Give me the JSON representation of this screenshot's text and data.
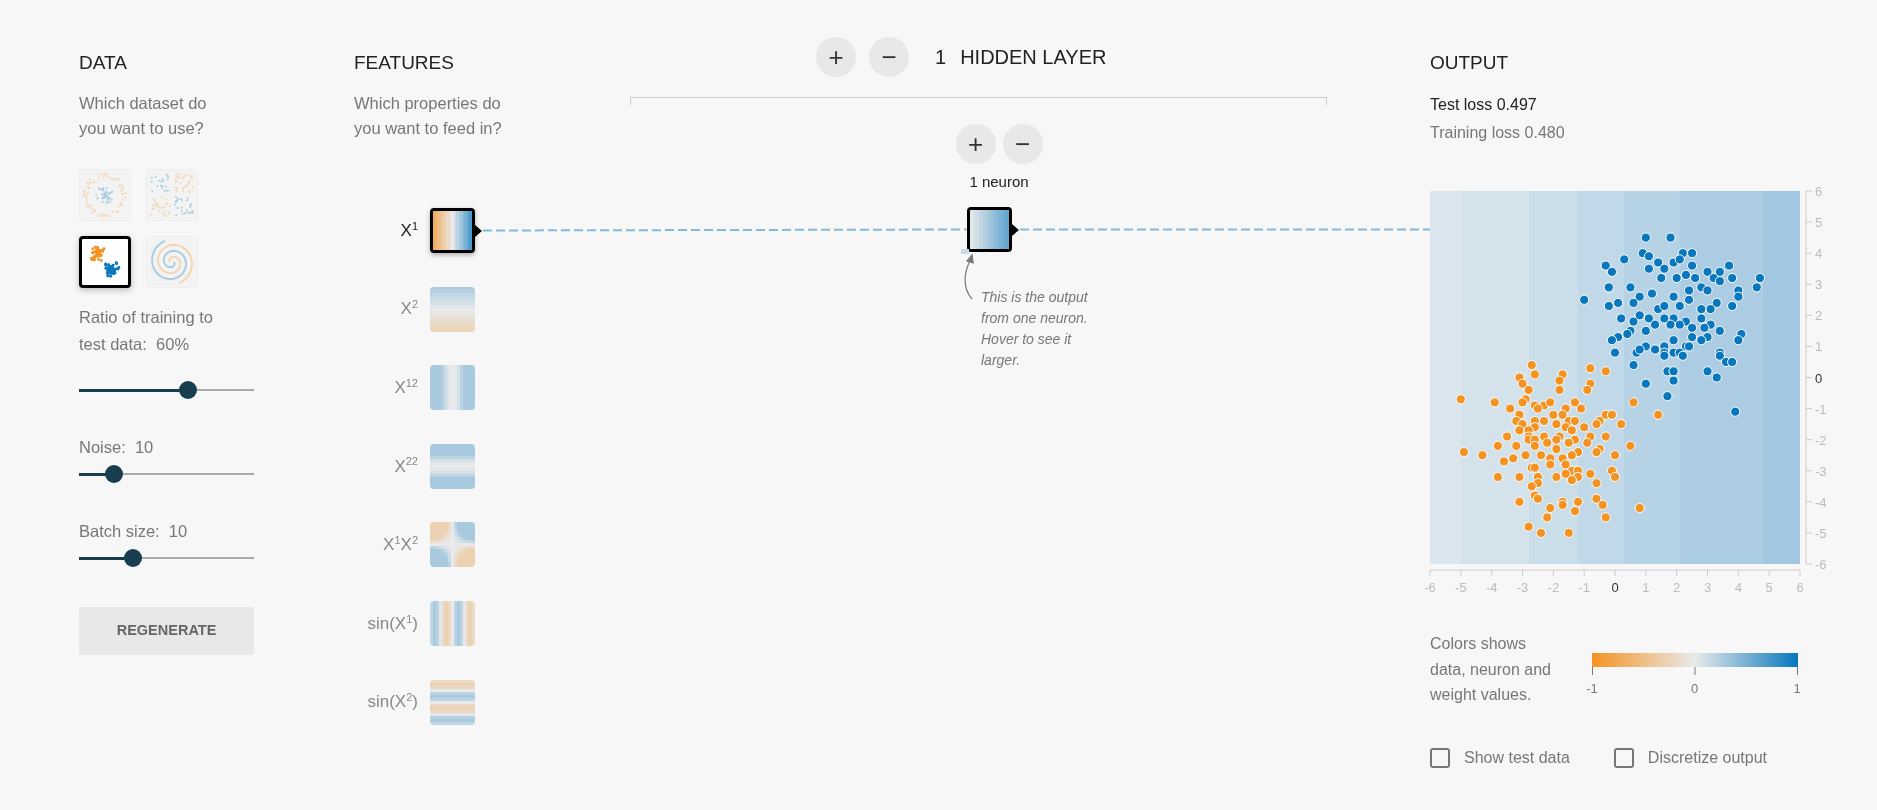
{
  "data_panel": {
    "title": "DATA",
    "subtitle": "Which dataset do you want to use?",
    "datasets": [
      {
        "kind": "circle",
        "selected": false
      },
      {
        "kind": "xor",
        "selected": false
      },
      {
        "kind": "gauss",
        "selected": true
      },
      {
        "kind": "spiral",
        "selected": false
      }
    ],
    "sliders": [
      {
        "label": "Ratio of training to test data:",
        "value": "60%",
        "level": 0.62
      },
      {
        "label": "Noise:",
        "value": "10",
        "level": 0.2
      },
      {
        "label": "Batch size:",
        "value": "10",
        "level": 0.31
      }
    ],
    "regenerate_button": "REGENERATE"
  },
  "features_panel": {
    "title": "FEATURES",
    "subtitle": "Which properties do you want to feed in?",
    "features": [
      {
        "label": "X$^{1}$",
        "kind": "x1",
        "selected": true
      },
      {
        "label": "X$^{2}$",
        "kind": "x2",
        "selected": false
      },
      {
        "label": "X$^{12}$",
        "kind": "x1sq",
        "selected": false
      },
      {
        "label": "X$^{22}$",
        "kind": "x2sq",
        "selected": false
      },
      {
        "label": "X$^{1}$X$^{2}$",
        "kind": "x1x2",
        "selected": false
      },
      {
        "label": "sin(X$^{1}$)",
        "kind": "sinx1",
        "selected": false
      },
      {
        "label": "sin(X$^{2}$)",
        "kind": "sinx2",
        "selected": false
      }
    ]
  },
  "network": {
    "add_layer_button": "+",
    "remove_layer_button": "−",
    "layer_count": "1",
    "layer_label": "HIDDEN LAYER",
    "layers": [
      {
        "add_neuron_button": "+",
        "remove_neuron_button": "−",
        "neuron_count": "1 neuron",
        "neurons": [
          {
            "kind": "neuron"
          }
        ]
      }
    ],
    "note": "This is the output from one neuron. Hover to see it larger."
  },
  "output_panel": {
    "title": "OUTPUT",
    "test_loss": "Test loss 0.497",
    "training_loss": "Training loss 0.480",
    "chart_data": {
      "type": "scatter",
      "xlim": [
        -6,
        6
      ],
      "ylim": [
        -6,
        6
      ],
      "xticks": [
        {
          "value": -6,
          "label": "-6"
        },
        {
          "value": -5,
          "label": "-5"
        },
        {
          "value": -4,
          "label": "-4"
        },
        {
          "value": -3,
          "label": "-3"
        },
        {
          "value": -2,
          "label": "-2"
        },
        {
          "value": -1,
          "label": "-1"
        },
        {
          "value": 0,
          "label": "0"
        },
        {
          "value": 1,
          "label": "1"
        },
        {
          "value": 2,
          "label": "2"
        },
        {
          "value": 3,
          "label": "3"
        },
        {
          "value": 4,
          "label": "4"
        },
        {
          "value": 5,
          "label": "5"
        },
        {
          "value": 6,
          "label": "6"
        }
      ],
      "yticks": [
        {
          "value": -6,
          "label": "-6"
        },
        {
          "value": -5,
          "label": "-5"
        },
        {
          "value": -4,
          "label": "-4"
        },
        {
          "value": -3,
          "label": "-3"
        },
        {
          "value": -2,
          "label": "-2"
        },
        {
          "value": -1,
          "label": "-1"
        },
        {
          "value": 0,
          "label": "0"
        },
        {
          "value": 1,
          "label": "1"
        },
        {
          "value": 2,
          "label": "2"
        },
        {
          "value": 3,
          "label": "3"
        },
        {
          "value": 4,
          "label": "4"
        },
        {
          "value": 5,
          "label": "5"
        },
        {
          "value": 6,
          "label": "6"
        }
      ],
      "series": [
        {
          "color": "#0877bd",
          "x": [
            1.0,
            1.8,
            0.9,
            2.2,
            2.5,
            1.1,
            1.4,
            1.9,
            2.1,
            0.3,
            -0.3,
            -0.1,
            1.1,
            1.6,
            2.5,
            3.0,
            3.7,
            3.4,
            3.8,
            4.7,
            4.6,
            4.0,
            4.0,
            3.8,
            3.3,
            3.2,
            3.4,
            2.3,
            1.5,
            2.0,
            2.6,
            -0.2,
            0.5,
            -1.0,
            -0.2,
            0.1,
            0.8,
            1.2,
            1.9,
            2.4,
            2.8,
            3.0,
            0.6,
            1.4,
            1.6,
            2.1,
            2.8,
            3.1,
            0.2,
            0.6,
            0.8,
            1.1,
            1.6,
            1.9,
            2.3,
            2.8,
            3.4,
            3.1,
            2.9,
            2.5,
            2.1,
            1.8,
            1.3,
            1.0,
            0.5,
            0.1,
            -0.1,
            0.4,
            1.9,
            2.5,
            3.0,
            2.8,
            4.1,
            4.0,
            1.0,
            1.3,
            1.6,
            2.3,
            2.4,
            0.0,
            0.7,
            0.8,
            1.6,
            1.9,
            2.1,
            1.6,
            2.2,
            3.4,
            3.4,
            3.6,
            3.8,
            0.6,
            1.7,
            1.9,
            3.0,
            3.3,
            1.0,
            1.9,
            1.7,
            3.9,
            2.4
          ],
          "values": [
            4.5,
            4.5,
            4.0,
            4.0,
            4.0,
            3.9,
            3.7,
            3.7,
            3.8,
            3.8,
            3.6,
            3.4,
            3.5,
            3.5,
            3.6,
            3.4,
            3.6,
            3.4,
            3.2,
            3.2,
            2.9,
            2.8,
            2.6,
            2.3,
            2.4,
            3.2,
            3.1,
            3.3,
            3.2,
            3.2,
            3.2,
            2.9,
            2.9,
            2.5,
            2.3,
            2.4,
            2.6,
            2.7,
            2.6,
            2.5,
            2.9,
            2.8,
            2.4,
            2.2,
            2.3,
            2.3,
            2.2,
            2.2,
            1.9,
            1.8,
            2.0,
            1.9,
            1.9,
            1.9,
            1.8,
            1.9,
            1.5,
            1.7,
            1.6,
            1.6,
            1.7,
            1.7,
            1.7,
            1.5,
            1.5,
            1.3,
            1.2,
            1.4,
            1.2,
            1.3,
            1.3,
            1.2,
            1.4,
            1.2,
            1.0,
            0.9,
            1.0,
            1.0,
            1.0,
            0.8,
            0.8,
            0.9,
            0.8,
            0.8,
            0.8,
            0.7,
            0.7,
            0.8,
            0.7,
            0.5,
            0.5,
            0.4,
            0.2,
            0.2,
            0.2,
            0.0,
            -0.2,
            -0.1,
            -0.6,
            -1.1,
            2.8
          ]
        },
        {
          "color": "#f59322",
          "x": [
            -2.7,
            -2.6,
            -3.1,
            -3.0,
            -2.8,
            -1.7,
            -1.8,
            -1.8,
            -0.8,
            -0.3,
            -0.8,
            -0.9,
            -5.0,
            -3.9,
            -2.9,
            -3.0,
            -2.6,
            -2.3,
            -2.1,
            -1.3,
            -1.1,
            -1.6,
            0.6,
            -3.4,
            -3.1,
            -2.5,
            -2.0,
            -1.7,
            -0.3,
            -0.1,
            1.4,
            -3.2,
            -2.6,
            -2.3,
            -1.5,
            -1.3,
            -0.5,
            0.2,
            -3.0,
            -2.6,
            -1.9,
            -1.0,
            -0.6,
            -3.1,
            -2.8,
            -1.6,
            -1.4,
            -0.8,
            -2.8,
            -2.3,
            -1.8,
            -3.5,
            -2.8,
            -2.6,
            -1.9,
            -1.3,
            -0.3,
            -2.2,
            -1.5,
            -3.8,
            -3.2,
            -2.6,
            -0.9,
            0.5,
            -1.9,
            -0.5,
            -4.9,
            -2.4,
            -1.2,
            -0.6,
            0.0,
            -4.3,
            -2.9,
            -2.1,
            -1.7,
            -1.4,
            -3.6,
            -3.3,
            -2.1,
            -1.6,
            -2.7,
            -2.6,
            -1.4,
            -1.2,
            -0.1,
            -3.8,
            -3.1,
            -1.9,
            -1.6,
            -1.2,
            -0.8,
            0.0,
            -2.5,
            -1.4,
            -2.5,
            -0.6,
            -2.7,
            -2.6,
            -2.5,
            -3.1,
            -0.6,
            -1.7,
            -1.2,
            -0.4,
            0.8,
            -2.1,
            -1.7,
            -1.3,
            -0.3,
            -2.2,
            -2.8,
            -2.4,
            -1.5
          ],
          "values": [
            0.4,
            0.1,
            0.0,
            -0.2,
            -0.4,
            0.1,
            -0.1,
            -0.4,
            0.3,
            0.2,
            -0.2,
            -0.4,
            -0.7,
            -0.8,
            -0.7,
            -0.8,
            -0.9,
            -0.9,
            -0.8,
            -0.8,
            -1.0,
            -1.0,
            -0.8,
            -1.0,
            -1.2,
            -1.0,
            -1.2,
            -1.2,
            -1.2,
            -1.2,
            -1.2,
            -1.4,
            -1.4,
            -1.4,
            -1.4,
            -1.4,
            -1.4,
            -1.5,
            -1.5,
            -1.6,
            -1.5,
            -1.6,
            -1.5,
            -1.7,
            -1.7,
            -1.6,
            -1.7,
            -1.9,
            -1.9,
            -1.9,
            -1.9,
            -1.9,
            -2.0,
            -2.0,
            -2.0,
            -2.0,
            -1.9,
            -2.1,
            -2.1,
            -2.2,
            -2.2,
            -2.2,
            -2.1,
            -2.2,
            -2.3,
            -2.3,
            -2.4,
            -2.5,
            -2.4,
            -2.4,
            -2.5,
            -2.5,
            -2.5,
            -2.6,
            -2.6,
            -2.5,
            -2.7,
            -2.6,
            -2.8,
            -2.8,
            -2.9,
            -2.9,
            -3.0,
            -3.0,
            -3.0,
            -3.2,
            -3.2,
            -3.2,
            -3.1,
            -3.2,
            -3.1,
            -3.2,
            -3.2,
            -3.3,
            -3.4,
            -3.4,
            -3.5,
            -3.8,
            -3.9,
            -4.0,
            -3.9,
            -4.0,
            -4.0,
            -4.1,
            -4.2,
            -4.2,
            -4.1,
            -4.3,
            -4.5,
            -4.5,
            -4.8,
            -5.0,
            -5.0
          ]
        }
      ]
    },
    "legend": {
      "text": "Colors shows data, neuron and weight values.",
      "scale_labels": [
        "-1",
        "0",
        "1"
      ]
    },
    "checkboxes": [
      {
        "label": "Show test data",
        "checked": false
      },
      {
        "label": "Discretize output",
        "checked": false
      }
    ]
  }
}
